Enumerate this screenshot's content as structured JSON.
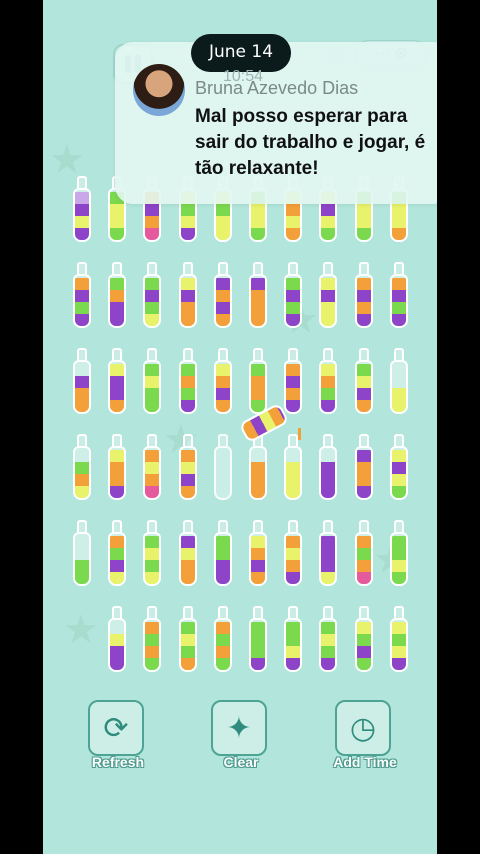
{
  "status": {
    "date": "June 14",
    "time": "10:54"
  },
  "notification": {
    "sender": "Bruna Azevedo Dias",
    "message": "Mal posso esperar para sair do trabalho e jogar, é tão relaxante!"
  },
  "colors": {
    "bg": "#b2e6dc",
    "purple": "#8e44c9",
    "green": "#7bd94e",
    "yellow": "#e8f26a",
    "orange": "#f4a03a",
    "pink": "#e45a9d",
    "lavender": "#c9a7e8"
  },
  "bottles": [
    [
      [
        "purple",
        "yellow",
        "purple",
        "lavender"
      ],
      [
        "green",
        "yellow",
        "yellow",
        "green"
      ],
      [
        "pink",
        "orange",
        "purple",
        "orange"
      ],
      [
        "purple",
        "yellow",
        "green",
        "yellow"
      ],
      [
        "yellow",
        "yellow",
        "green",
        "yellow"
      ],
      [
        "green",
        "yellow",
        "yellow",
        "green"
      ],
      [
        "orange",
        "yellow",
        "orange",
        "yellow"
      ],
      [
        "green",
        "yellow",
        "purple",
        "yellow"
      ],
      [
        "green",
        "yellow",
        "yellow",
        "green"
      ],
      [
        "orange",
        "yellow",
        "yellow",
        "green"
      ]
    ],
    [
      [
        "purple",
        "green",
        "purple",
        "orange"
      ],
      [
        "purple",
        "purple",
        "orange",
        "green"
      ],
      [
        "yellow",
        "green",
        "purple",
        "green"
      ],
      [
        "orange",
        "orange",
        "purple",
        "yellow"
      ],
      [
        "orange",
        "purple",
        "orange",
        "purple"
      ],
      [
        "orange",
        "orange",
        "orange",
        "purple"
      ],
      [
        "purple",
        "green",
        "purple",
        "green"
      ],
      [
        "yellow",
        "yellow",
        "purple",
        "yellow"
      ],
      [
        "purple",
        "orange",
        "purple",
        "orange"
      ],
      [
        "purple",
        "green",
        "purple",
        "orange"
      ]
    ],
    [
      [
        "orange",
        "orange",
        "purple",
        ""
      ],
      [
        "orange",
        "purple",
        "purple",
        "yellow"
      ],
      [
        "green",
        "green",
        "yellow",
        "green"
      ],
      [
        "purple",
        "green",
        "orange",
        "green"
      ],
      [
        "orange",
        "purple",
        "orange",
        "yellow"
      ],
      [
        "green",
        "orange",
        "orange",
        "green"
      ],
      [
        "purple",
        "orange",
        "purple",
        "orange"
      ],
      [
        "purple",
        "green",
        "orange",
        "yellow"
      ],
      [
        "orange",
        "purple",
        "yellow",
        "green"
      ],
      [
        "yellow",
        "yellow",
        "",
        ""
      ]
    ],
    [
      [
        "yellow",
        "orange",
        "green",
        ""
      ],
      [
        "purple",
        "orange",
        "orange",
        "yellow"
      ],
      [
        "pink",
        "orange",
        "yellow",
        "orange"
      ],
      [
        "orange",
        "purple",
        "yellow",
        "orange"
      ],
      [
        "",
        "",
        "",
        ""
      ],
      [
        "orange",
        "orange",
        "orange",
        ""
      ],
      [
        "yellow",
        "yellow",
        "yellow",
        ""
      ],
      [
        "purple",
        "purple",
        "purple",
        ""
      ],
      [
        "purple",
        "orange",
        "orange",
        "purple"
      ],
      [
        "green",
        "yellow",
        "purple",
        "yellow"
      ]
    ],
    [
      [
        "green",
        "green",
        "",
        ""
      ],
      [
        "yellow",
        "purple",
        "green",
        "orange"
      ],
      [
        "yellow",
        "green",
        "yellow",
        "green"
      ],
      [
        "orange",
        "orange",
        "yellow",
        "purple"
      ],
      [
        "purple",
        "purple",
        "green",
        "green"
      ],
      [
        "orange",
        "purple",
        "orange",
        "yellow"
      ],
      [
        "purple",
        "orange",
        "yellow",
        "orange"
      ],
      [
        "yellow",
        "purple",
        "purple",
        "purple"
      ],
      [
        "pink",
        "orange",
        "green",
        "orange"
      ],
      [
        "green",
        "yellow",
        "green",
        "green"
      ]
    ],
    [
      [
        "purple",
        "purple",
        "yellow",
        ""
      ],
      [
        "green",
        "orange",
        "green",
        "orange"
      ],
      [
        "orange",
        "green",
        "yellow",
        "green"
      ],
      [
        "green",
        "orange",
        "green",
        "orange"
      ],
      [
        "purple",
        "green",
        "green",
        "green"
      ],
      [
        "purple",
        "yellow",
        "green",
        "green"
      ],
      [
        "purple",
        "green",
        "yellow",
        "green"
      ],
      [
        "green",
        "purple",
        "green",
        "yellow"
      ],
      [
        "purple",
        "yellow",
        "green",
        "yellow"
      ]
    ]
  ],
  "toolbar": {
    "refresh": "Refresh",
    "clear": "Clear",
    "add_time": "Add Time"
  },
  "icons": {
    "refresh": "refresh-icon",
    "clear": "magic-wand-icon",
    "add_time": "clock-icon"
  }
}
